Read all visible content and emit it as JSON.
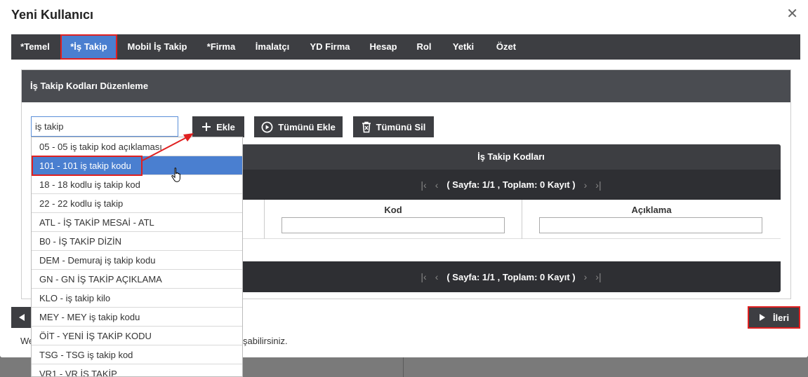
{
  "modal": {
    "title": "Yeni Kullanıcı",
    "close_glyph": "✕"
  },
  "tabs": [
    {
      "label": "*Temel"
    },
    {
      "label": "*İş Takip",
      "active": true
    },
    {
      "label": "Mobil İş Takip"
    },
    {
      "label": "*Firma"
    },
    {
      "label": "İmalatçı"
    },
    {
      "label": "YD Firma"
    },
    {
      "label": "Hesap"
    },
    {
      "label": "Rol"
    },
    {
      "label": "Yetki"
    },
    {
      "label": "Özet"
    }
  ],
  "panel": {
    "title": "İş Takip Kodları Düzenleme"
  },
  "search": {
    "value": "iş takip"
  },
  "buttons": {
    "add": "Ekle",
    "add_all": "Tümünü Ekle",
    "remove_all": "Tümünü Sil",
    "next": "İleri"
  },
  "grid": {
    "title": "İş Takip Kodları",
    "pager_text": "( Sayfa: 1/1 , Toplam: 0 Kayıt )",
    "columns": [
      "Kod",
      "Açıklama"
    ]
  },
  "dropdown": {
    "items": [
      "05 - 05 iş takip kod açıklaması",
      "101 - 101 iş takip kodu",
      "18 - 18 kodlu iş takip kod",
      "22 - 22 kodlu iş takip",
      "ATL - İŞ TAKİP MESAİ - ATL",
      "B0 - İŞ TAKİP DİZİN",
      "DEM - Demuraj iş takip kodu",
      "GN - GN İŞ TAKİP AÇIKLAMA",
      "KLO - iş takip kilo",
      "MEY - MEY iş takip kodu",
      "ÖİT - YENİ İŞ TAKİP KODU",
      "TSG - TSG iş takip kod",
      "VR1 - VR İŞ TAKİP"
    ],
    "selected_index": 1
  },
  "footer": {
    "text_left": "We",
    "text_right": "şabilirsiniz."
  },
  "colors": {
    "accent": "#4a7fd0",
    "dark": "#3d3e42",
    "highlight": "#e02020"
  }
}
